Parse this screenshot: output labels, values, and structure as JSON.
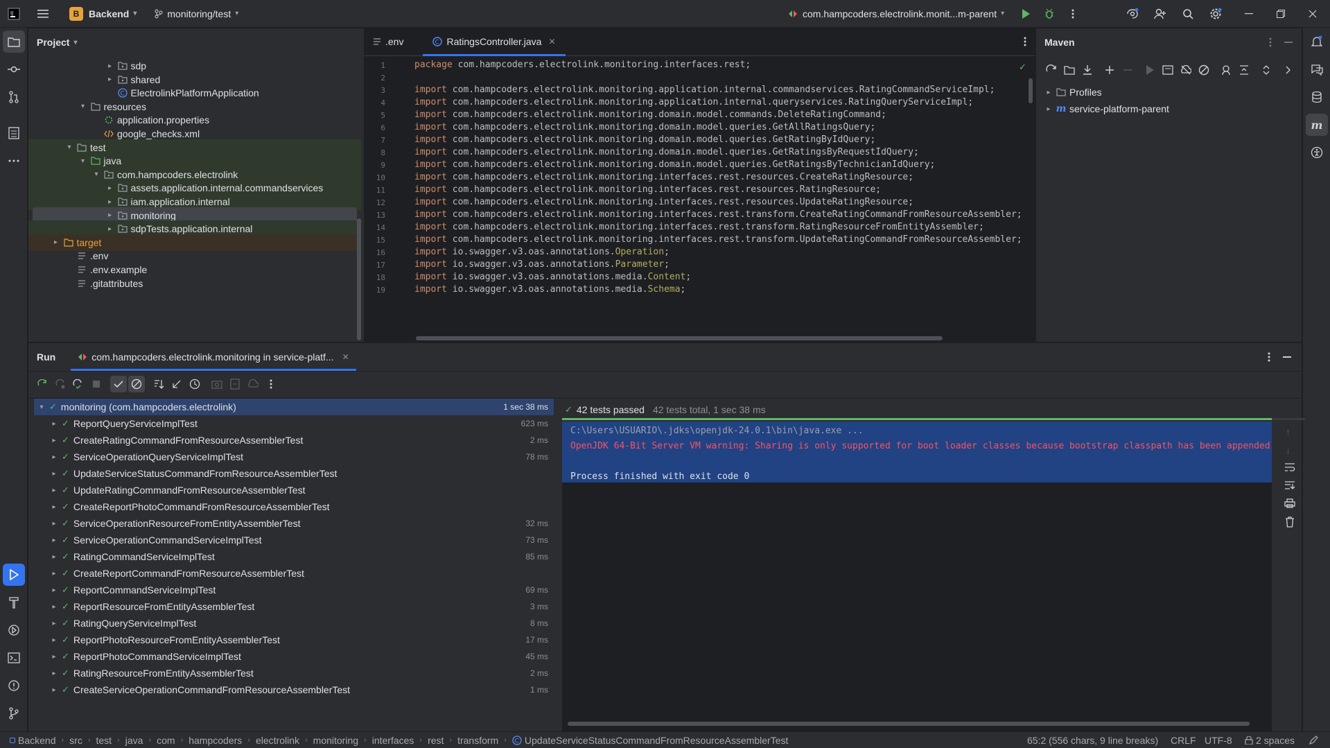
{
  "titlebar": {
    "project_badge": "B",
    "project_name": "Backend",
    "branch": "monitoring/test",
    "run_config": "com.hampcoders.electrolink.monit...m-parent"
  },
  "project_panel": {
    "title": "Project",
    "items": [
      {
        "label": "sdp",
        "indent": 5,
        "type": "package",
        "arrow": "right"
      },
      {
        "label": "shared",
        "indent": 5,
        "type": "package",
        "arrow": "right"
      },
      {
        "label": "ElectrolinkPlatformApplication",
        "indent": 5,
        "type": "class",
        "arrow": ""
      },
      {
        "label": "resources",
        "indent": 3,
        "type": "folder",
        "arrow": "down"
      },
      {
        "label": "application.properties",
        "indent": 4,
        "type": "props",
        "arrow": ""
      },
      {
        "label": "google_checks.xml",
        "indent": 4,
        "type": "xml",
        "arrow": ""
      },
      {
        "label": "test",
        "indent": 2,
        "type": "folder",
        "arrow": "down"
      },
      {
        "label": "java",
        "indent": 3,
        "type": "folder-green",
        "arrow": "down"
      },
      {
        "label": "com.hampcoders.electrolink",
        "indent": 4,
        "type": "package",
        "arrow": "down"
      },
      {
        "label": "assets.application.internal.commandservices",
        "indent": 5,
        "type": "package",
        "arrow": "right"
      },
      {
        "label": "iam.application.internal",
        "indent": 5,
        "type": "package",
        "arrow": "right"
      },
      {
        "label": "monitoring",
        "indent": 5,
        "type": "package",
        "arrow": "right"
      },
      {
        "label": "sdpTests.application.internal",
        "indent": 5,
        "type": "package",
        "arrow": "right"
      },
      {
        "label": "target",
        "indent": 1,
        "type": "folder-orange",
        "arrow": "right"
      },
      {
        "label": ".env",
        "indent": 2,
        "type": "text",
        "arrow": ""
      },
      {
        "label": ".env.example",
        "indent": 2,
        "type": "text",
        "arrow": ""
      },
      {
        "label": ".gitattributes",
        "indent": 2,
        "type": "text",
        "arrow": ""
      }
    ]
  },
  "editor": {
    "tabs": [
      {
        "label": ".env",
        "active": false
      },
      {
        "label": "RatingsController.java",
        "active": true
      }
    ],
    "lines": [
      {
        "n": "1",
        "kw": "package",
        "body": " com.hampcoders.electrolink.monitoring.interfaces.rest;",
        "hl": ""
      },
      {
        "n": "2",
        "kw": "",
        "body": "",
        "hl": ""
      },
      {
        "n": "3",
        "kw": "import",
        "body": " com.hampcoders.electrolink.monitoring.application.internal.commandservices.RatingCommandServiceImpl;",
        "hl": ""
      },
      {
        "n": "4",
        "kw": "import",
        "body": " com.hampcoders.electrolink.monitoring.application.internal.queryservices.RatingQueryServiceImpl;",
        "hl": ""
      },
      {
        "n": "5",
        "kw": "import",
        "body": " com.hampcoders.electrolink.monitoring.domain.model.commands.DeleteRatingCommand;",
        "hl": ""
      },
      {
        "n": "6",
        "kw": "import",
        "body": " com.hampcoders.electrolink.monitoring.domain.model.queries.GetAllRatingsQuery;",
        "hl": ""
      },
      {
        "n": "7",
        "kw": "import",
        "body": " com.hampcoders.electrolink.monitoring.domain.model.queries.GetRatingByIdQuery;",
        "hl": ""
      },
      {
        "n": "8",
        "kw": "import",
        "body": " com.hampcoders.electrolink.monitoring.domain.model.queries.GetRatingsByRequestIdQuery;",
        "hl": ""
      },
      {
        "n": "9",
        "kw": "import",
        "body": " com.hampcoders.electrolink.monitoring.domain.model.queries.GetRatingsByTechnicianIdQuery;",
        "hl": ""
      },
      {
        "n": "10",
        "kw": "import",
        "body": " com.hampcoders.electrolink.monitoring.interfaces.rest.resources.CreateRatingResource;",
        "hl": ""
      },
      {
        "n": "11",
        "kw": "import",
        "body": " com.hampcoders.electrolink.monitoring.interfaces.rest.resources.RatingResource;",
        "hl": ""
      },
      {
        "n": "12",
        "kw": "import",
        "body": " com.hampcoders.electrolink.monitoring.interfaces.rest.resources.UpdateRatingResource;",
        "hl": ""
      },
      {
        "n": "13",
        "kw": "import",
        "body": " com.hampcoders.electrolink.monitoring.interfaces.rest.transform.CreateRatingCommandFromResourceAssembler;",
        "hl": ""
      },
      {
        "n": "14",
        "kw": "import",
        "body": " com.hampcoders.electrolink.monitoring.interfaces.rest.transform.RatingResourceFromEntityAssembler;",
        "hl": ""
      },
      {
        "n": "15",
        "kw": "import",
        "body": " com.hampcoders.electrolink.monitoring.interfaces.rest.transform.UpdateRatingCommandFromResourceAssembler;",
        "hl": ""
      },
      {
        "n": "16",
        "kw": "import",
        "body": " io.swagger.v3.oas.annotations.",
        "hl": "Operation",
        "tail": ";"
      },
      {
        "n": "17",
        "kw": "import",
        "body": " io.swagger.v3.oas.annotations.",
        "hl": "Parameter",
        "tail": ";"
      },
      {
        "n": "18",
        "kw": "import",
        "body": " io.swagger.v3.oas.annotations.media.",
        "hl": "Content",
        "tail": ";"
      },
      {
        "n": "19",
        "kw": "import",
        "body": " io.swagger.v3.oas.annotations.media.",
        "hl": "Schema",
        "tail": ";"
      }
    ]
  },
  "maven": {
    "title": "Maven",
    "items": [
      {
        "label": "Profiles"
      },
      {
        "label": "service-platform-parent"
      }
    ]
  },
  "run": {
    "label": "Run",
    "tab": "com.hampcoders.electrolink.monitoring in service-platf...",
    "summary_passed": "42 tests passed",
    "summary_total": "42 tests total, 1 sec 38 ms",
    "root": {
      "label": "monitoring (com.hampcoders.electrolink)",
      "dur": "1 sec 38 ms"
    },
    "tests": [
      {
        "label": "ReportQueryServiceImplTest",
        "dur": "623 ms"
      },
      {
        "label": "CreateRatingCommandFromResourceAssemblerTest",
        "dur": "2 ms"
      },
      {
        "label": "ServiceOperationQueryServiceImplTest",
        "dur": "78 ms"
      },
      {
        "label": "UpdateServiceStatusCommandFromResourceAssemblerTest",
        "dur": ""
      },
      {
        "label": "UpdateRatingCommandFromResourceAssemblerTest",
        "dur": ""
      },
      {
        "label": "CreateReportPhotoCommandFromResourceAssemblerTest",
        "dur": ""
      },
      {
        "label": "ServiceOperationResourceFromEntityAssemblerTest",
        "dur": "32 ms"
      },
      {
        "label": "ServiceOperationCommandServiceImplTest",
        "dur": "73 ms"
      },
      {
        "label": "RatingCommandServiceImplTest",
        "dur": "85 ms"
      },
      {
        "label": "CreateReportCommandFromResourceAssemblerTest",
        "dur": ""
      },
      {
        "label": "ReportCommandServiceImplTest",
        "dur": "69 ms"
      },
      {
        "label": "ReportResourceFromEntityAssemblerTest",
        "dur": "3 ms"
      },
      {
        "label": "RatingQueryServiceImplTest",
        "dur": "8 ms"
      },
      {
        "label": "ReportPhotoResourceFromEntityAssemblerTest",
        "dur": "17 ms"
      },
      {
        "label": "ReportPhotoCommandServiceImplTest",
        "dur": "45 ms"
      },
      {
        "label": "RatingResourceFromEntityAssemblerTest",
        "dur": "2 ms"
      },
      {
        "label": "CreateServiceOperationCommandFromResourceAssemblerTest",
        "dur": "1 ms"
      }
    ],
    "console": [
      {
        "text": "C:\\Users\\USUARIO\\.jdks\\openjdk-24.0.1\\bin\\java.exe ...",
        "color": "#9da0a8"
      },
      {
        "text": "OpenJDK 64-Bit Server VM warning: Sharing is only supported for boot loader classes because bootstrap classpath has been appended",
        "color": "#f75464"
      },
      {
        "text": "",
        "color": "#dfe1e5"
      },
      {
        "text": "Process finished with exit code 0",
        "color": "#dfe1e5"
      }
    ]
  },
  "statusbar": {
    "breadcrumbs": [
      "Backend",
      "src",
      "test",
      "java",
      "com",
      "hampcoders",
      "electrolink",
      "monitoring",
      "interfaces",
      "rest",
      "transform",
      "UpdateServiceStatusCommandFromResourceAssemblerTest"
    ],
    "position": "65:2 (556 chars, 9 line breaks)",
    "line_sep": "CRLF",
    "encoding": "UTF-8",
    "indent": "2 spaces"
  },
  "colors": {
    "accent": "#3574f0",
    "pass": "#5fb865",
    "error": "#f75464",
    "keyword": "#cf8e6d"
  }
}
